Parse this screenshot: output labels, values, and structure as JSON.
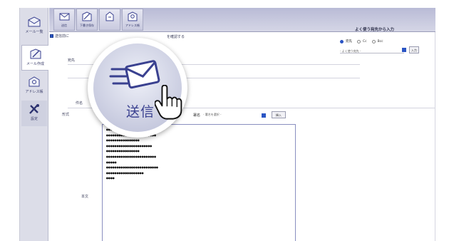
{
  "sidebar": {
    "items": [
      {
        "label": "メール一覧",
        "icon": "envelope-icon"
      },
      {
        "label": "メール作成",
        "icon": "compose-icon"
      },
      {
        "label": "アドレス帳",
        "icon": "addressbook-icon"
      },
      {
        "label": "設定",
        "icon": "tools-icon"
      }
    ]
  },
  "toolbar": {
    "buttons": [
      {
        "label": "送信",
        "icon": "send-icon"
      },
      {
        "label": "下書き保存",
        "icon": "draft-icon"
      },
      {
        "label": "",
        "icon": "attach-icon"
      },
      {
        "label": "アドレス帳",
        "icon": "addressbook-icon"
      }
    ],
    "confirm_label": "送信前に",
    "confirm_label2": "を確認する"
  },
  "form": {
    "to_label": "宛先",
    "subject_label": "件名",
    "format_label": "形式",
    "body_label": "本文"
  },
  "address_panel": {
    "title": "よく使う宛先から入力",
    "radio_to": "宛先",
    "radio_cc": "Cc",
    "radio_bcc": "Bcc",
    "select_placeholder": "- よく使う宛先 -",
    "add_button": "入力"
  },
  "signature": {
    "label": "署名",
    "select_value": "- 署名を選択 -",
    "insert_button": "挿入"
  },
  "body_text": [
    "••••",
    "••••••••••••••••••••••••",
    "••••••••••••••••",
    "••••••••••••••••••••••",
    "••••••••••••••••",
    "",
    "••••••••••••••••••••••••",
    "•••••",
    "",
    "•••••••••••••••••••••••••",
    "••••••••••••••••••",
    "",
    "••••"
  ],
  "magnifier": {
    "label": "送信",
    "icon": "send-envelope-icon",
    "cursor": "hand-pointer-icon"
  },
  "colors": {
    "accent": "#3a4190",
    "toolbar": "#c9cadf",
    "sidebar": "#dcdde8",
    "checkbox": "#2b55c4"
  }
}
